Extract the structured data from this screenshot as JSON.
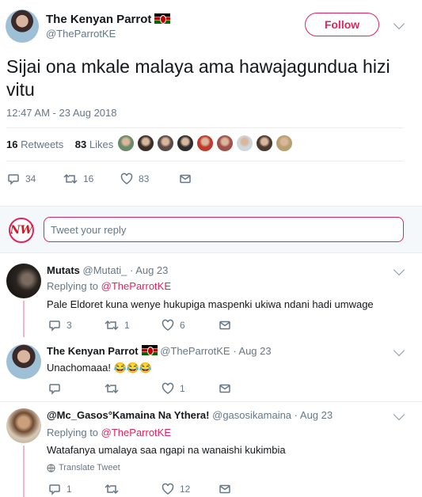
{
  "main_tweet": {
    "name": "The Kenyan Parrot",
    "handle": "@TheParrotKE",
    "follow_label": "Follow",
    "text": "Sijai ona mkale malaya ama hawajagundua hizi vitu",
    "timestamp": "12:47 AM - 23 Aug 2018",
    "retweets_count": "16",
    "retweets_label": "Retweets",
    "likes_count": "83",
    "likes_label": "Likes",
    "likers": [
      "#6a8a6a",
      "#3a2e2a",
      "#5a4a48",
      "#2d2d2d",
      "#c0392b",
      "#a0504a",
      "#cfd6dc",
      "#4a3a30",
      "#b7a070"
    ],
    "actions": {
      "replies": "34",
      "retweets": "16",
      "likes": "83"
    }
  },
  "reply_box": {
    "placeholder": "Tweet your reply",
    "logo_text": "NW"
  },
  "replies": [
    {
      "name": "Mutats",
      "handle": "@Mutati_",
      "time": "· Aug 23",
      "replying_prefix": "Replying to",
      "replying_to": "@TheParrotKE",
      "text": "Pale Eldoret kuna wenye hukupiga maspenki ukiwa ndani hadi umwage",
      "replies": "3",
      "retweets": "1",
      "likes": "6"
    },
    {
      "name": "The Kenyan Parrot",
      "handle": "@TheParrotKE",
      "time": "· Aug 23",
      "text": "Unachomaaa! 😂😂😂",
      "replies": "",
      "retweets": "",
      "likes": "1"
    },
    {
      "name": "@Mc_Gasos°Kamaina Na Ythera!",
      "handle": "@gasosikamaina",
      "time": "· Aug 23",
      "replying_prefix": "Replying to",
      "replying_to": "@TheParrotKE",
      "text": "Watafanya umalaya saa ngapi na wanaishi kukimbia",
      "translate": "Translate Tweet",
      "replies": "1",
      "retweets": "",
      "likes": "12"
    }
  ],
  "colors": {
    "accent": "#e0245e",
    "muted": "#657786",
    "divider": "#e6ecf0"
  }
}
